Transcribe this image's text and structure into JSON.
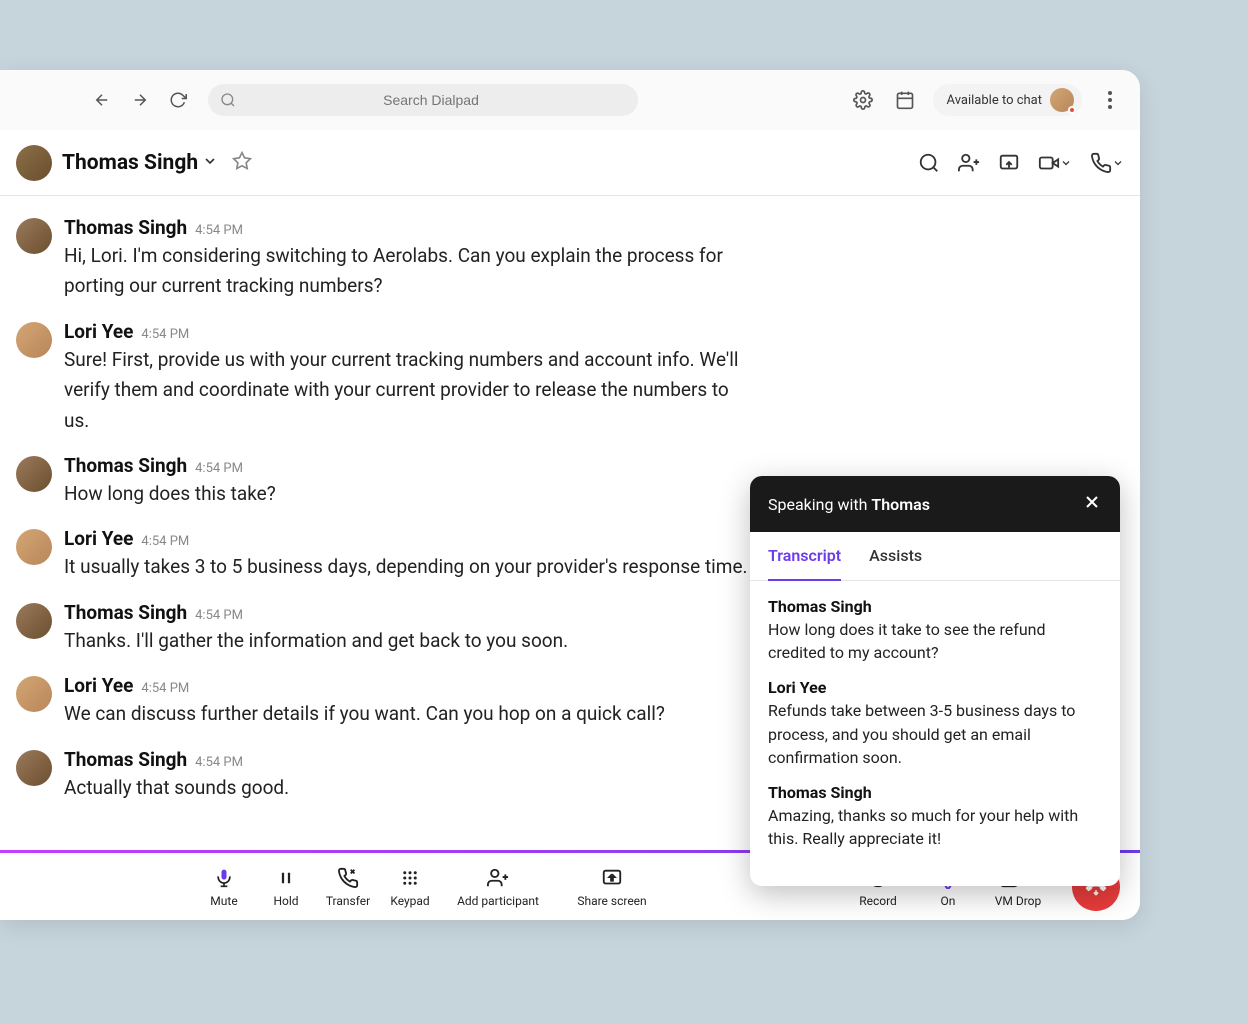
{
  "topbar": {
    "search_placeholder": "Search Dialpad",
    "status_text": "Available to chat"
  },
  "conversation": {
    "title": "Thomas Singh"
  },
  "messages": [
    {
      "author": "Thomas Singh",
      "time": "4:54 PM",
      "text": "Hi, Lori. I'm considering switching to Aerolabs. Can you explain the process for porting our current tracking numbers?",
      "avatar": "thomas"
    },
    {
      "author": "Lori Yee",
      "time": "4:54 PM",
      "text": "Sure! First, provide us with your current tracking numbers and account info. We'll verify them and coordinate with your current provider to release the numbers to us.",
      "avatar": "lori"
    },
    {
      "author": "Thomas Singh",
      "time": "4:54 PM",
      "text": "How long does this take?",
      "avatar": "thomas"
    },
    {
      "author": "Lori Yee",
      "time": "4:54 PM",
      "text": "It usually takes 3 to 5 business days, depending on your provider's response time.",
      "avatar": "lori"
    },
    {
      "author": "Thomas Singh",
      "time": "4:54 PM",
      "text": "Thanks. I'll gather the information and get back to you soon.",
      "avatar": "thomas"
    },
    {
      "author": "Lori Yee",
      "time": "4:54 PM",
      "text": "We can discuss further details if you want. Can you hop on a quick call?",
      "avatar": "lori"
    },
    {
      "author": "Thomas Singh",
      "time": "4:54 PM",
      "text": "Actually that sounds good.",
      "avatar": "thomas"
    }
  ],
  "ai_panel": {
    "header_prefix": "Speaking with ",
    "header_name": "Thomas",
    "tabs": {
      "transcript": "Transcript",
      "assists": "Assists"
    },
    "entries": [
      {
        "speaker": "Thomas Singh",
        "text": "How long does it take to see the refund credited to my account?"
      },
      {
        "speaker": "Lori Yee",
        "text": "Refunds take between 3-5 business days to process, and you should get an email confirmation soon."
      },
      {
        "speaker": "Thomas Singh",
        "text": "Amazing, thanks so much for your help with this. Really appreciate it!"
      }
    ]
  },
  "callbar": {
    "mute": "Mute",
    "hold": "Hold",
    "transfer": "Transfer",
    "keypad": "Keypad",
    "add_participant": "Add participant",
    "share_screen": "Share screen",
    "record": "Record",
    "ai_on": "On",
    "vm_drop": "VM Drop"
  }
}
